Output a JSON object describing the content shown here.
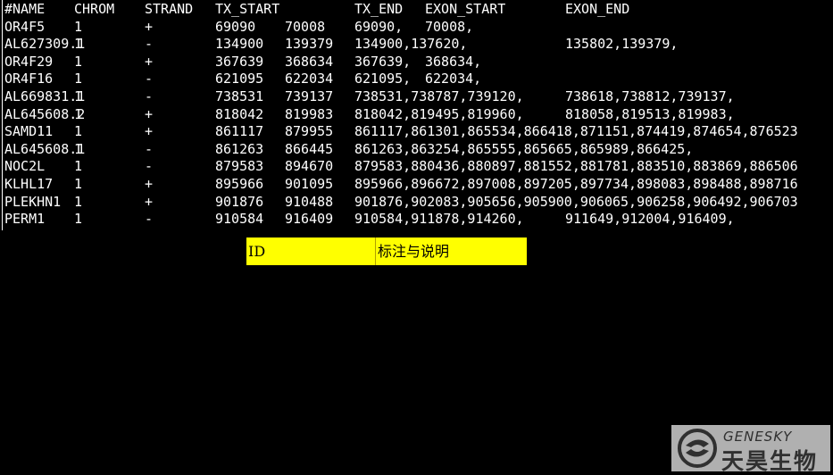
{
  "table": {
    "header": [
      "#NAME",
      "CHROM",
      "STRAND",
      "TX_START",
      "",
      "TX_END",
      "EXON_START",
      "EXON_END"
    ],
    "rows": [
      [
        "OR4F5",
        "1",
        "+",
        "69090",
        "70008",
        "69090,",
        "70008,",
        ""
      ],
      [
        "AL627309.1",
        "1",
        "-",
        "134900",
        "139379",
        "134900,137620,",
        "",
        "135802,139379,"
      ],
      [
        "OR4F29",
        "1",
        "+",
        "367639",
        "368634",
        "367639,",
        "368634,",
        ""
      ],
      [
        "OR4F16",
        "1",
        "-",
        "621095",
        "622034",
        "621095,",
        "622034,",
        ""
      ],
      [
        "AL669831.1",
        "1",
        "-",
        "738531",
        "739137",
        "738531,738787,739120,",
        "",
        "738618,738812,739137,"
      ],
      [
        "AL645608.2",
        "1",
        "+",
        "818042",
        "819983",
        "818042,819495,819960,",
        "",
        "818058,819513,819983,"
      ],
      [
        "SAMD11",
        "1",
        "+",
        "861117",
        "879955",
        "861117,861301,865534,866418,871151,874419,874654,876523",
        "",
        ""
      ],
      [
        "AL645608.1",
        "1",
        "-",
        "861263",
        "866445",
        "861263,863254,865555,865665,865989,866425,",
        "",
        ""
      ],
      [
        "NOC2L",
        "1",
        "-",
        "879583",
        "894670",
        "879583,880436,880897,881552,881781,883510,883869,886506",
        "",
        ""
      ],
      [
        "KLHL17",
        "1",
        "+",
        "895966",
        "901095",
        "895966,896672,897008,897205,897734,898083,898488,898716",
        "",
        ""
      ],
      [
        "PLEKHN1",
        "1",
        "+",
        "901876",
        "910488",
        "901876,902083,905656,905900,906065,906258,906492,906703",
        "",
        ""
      ],
      [
        "PERM1",
        "1",
        "-",
        "910584",
        "916409",
        "910584,911878,914260,",
        "",
        "911649,912004,916409,"
      ]
    ]
  },
  "legend": {
    "id_label": "ID",
    "note_label": "标注与说明",
    "background": "#ffff00"
  },
  "watermark": {
    "brand_en": "GENESKY",
    "brand_cn": "天昊生物"
  },
  "colors": {
    "terminal_bg": "#000000",
    "terminal_fg": "#ffffff"
  }
}
